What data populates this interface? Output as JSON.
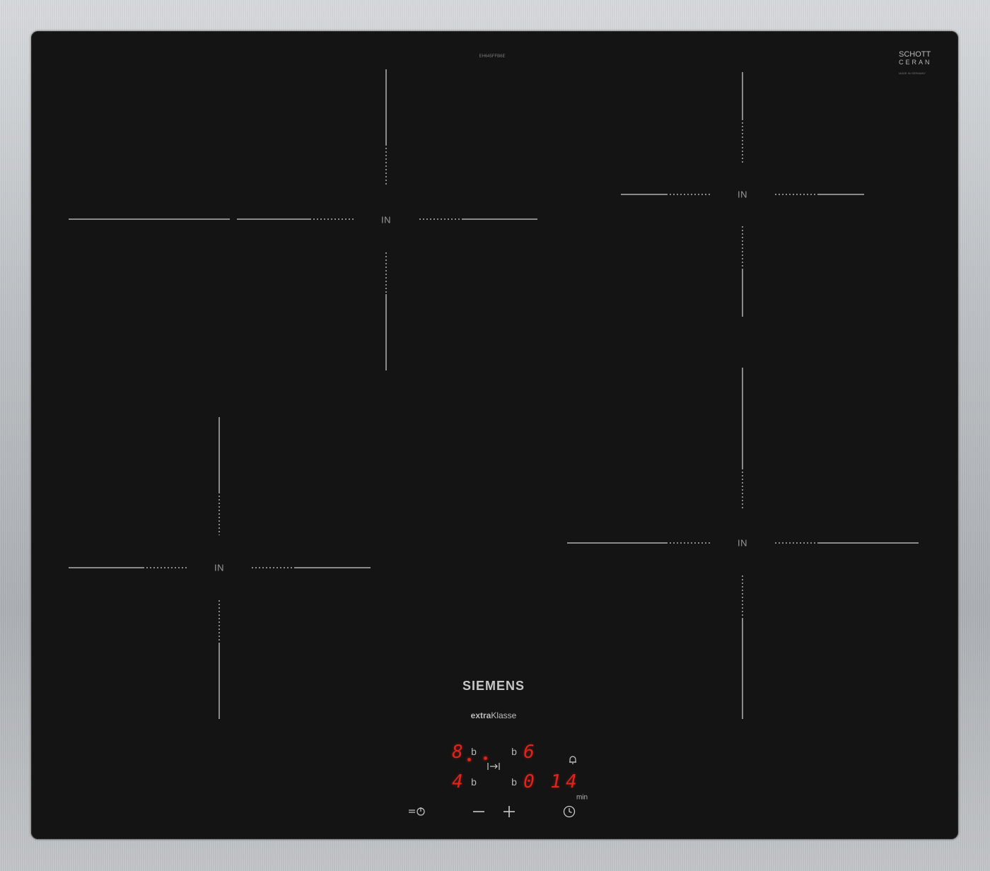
{
  "cooktop": {
    "brand": "SIEMENS",
    "series_prefix": "extra",
    "series_suffix": "Klasse",
    "model_code": "EH645FFB6E",
    "glass_logo_line1": "SCHOTT",
    "glass_logo_line2": "CERAN",
    "glass_logo_line3": "MADE IN GERMANY"
  },
  "zones": [
    {
      "id": "rear-left",
      "label": "IN"
    },
    {
      "id": "rear-right",
      "label": "IN"
    },
    {
      "id": "front-left",
      "label": "IN"
    },
    {
      "id": "front-right",
      "label": "IN"
    }
  ],
  "display": {
    "rear_left_level": "8",
    "rear_right_level": "6",
    "front_left_level": "4",
    "front_right_level": "0",
    "booster_mark": "b",
    "timer_value": "14",
    "timer_unit": "min"
  },
  "controls": {
    "power_icon": "power-key-icon",
    "minus_icon": "minus-icon",
    "plus_icon": "plus-icon",
    "timer_icon": "clock-icon",
    "alarm_icon": "bell-icon",
    "powerboost_icon": "arrow-to-bar-icon"
  }
}
